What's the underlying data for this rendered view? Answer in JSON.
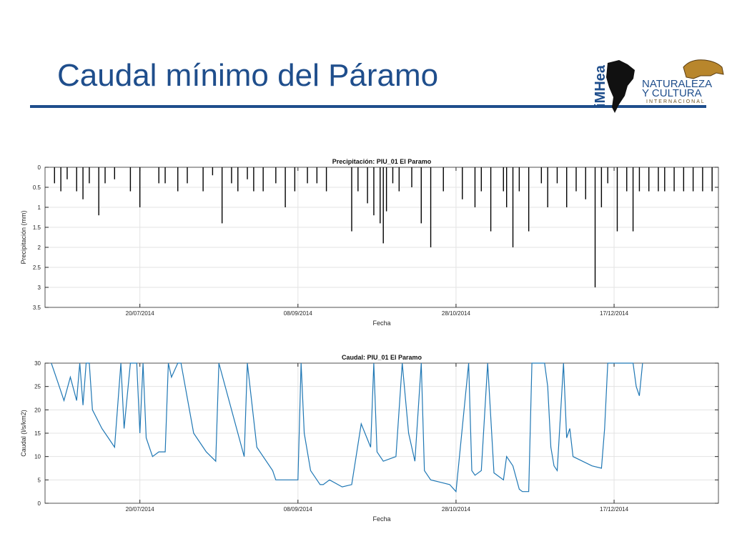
{
  "slide": {
    "title": "Caudal mínimo del Páramo",
    "logo_left_text": "iMHea",
    "logo_right_lines": [
      "NATURALEZA",
      "Y CULTURA",
      "INTERNACIONAL"
    ],
    "logo_icons": [
      "south-america-map-icon",
      "jaguar-icon"
    ],
    "colors": {
      "title": "#1f4e8c",
      "rule": "#1f4e8c",
      "precip_bars": "#000000",
      "flow_line": "#1f77b4"
    }
  },
  "chart_data": [
    {
      "type": "bar",
      "title": "Precipitación: PIU_01 El Paramo",
      "xlabel": "Fecha",
      "ylabel": "Precipitación (mm)",
      "y_reversed": true,
      "ylim": [
        0,
        3.5
      ],
      "yticks": [
        0,
        0.5,
        1,
        1.5,
        2,
        2.5,
        3,
        3.5
      ],
      "ytick_labels": [
        "0",
        "0.5",
        "1",
        "1.5",
        "2",
        "2.5",
        "3",
        "3.5"
      ],
      "xlim": [
        "2014-06-20",
        "2015-01-19"
      ],
      "xticks": [
        "2014-07-20",
        "2014-09-08",
        "2014-10-28",
        "2014-12-17"
      ],
      "xtick_labels": [
        "20/07/2014",
        "08/09/2014",
        "28/10/2014",
        "17/12/2014"
      ],
      "grid": true,
      "series": [
        {
          "dates": [
            "2014-06-23",
            "2014-06-25",
            "2014-06-27",
            "2014-06-30",
            "2014-07-02",
            "2014-07-04",
            "2014-07-07",
            "2014-07-09",
            "2014-07-12",
            "2014-07-17",
            "2014-07-20",
            "2014-07-26",
            "2014-07-28",
            "2014-08-01",
            "2014-08-04",
            "2014-08-09",
            "2014-08-12",
            "2014-08-15",
            "2014-08-18",
            "2014-08-20",
            "2014-08-23",
            "2014-08-25",
            "2014-08-28",
            "2014-09-01",
            "2014-09-04",
            "2014-09-07",
            "2014-09-11",
            "2014-09-14",
            "2014-09-17",
            "2014-09-25",
            "2014-09-27",
            "2014-09-30",
            "2014-10-02",
            "2014-10-04",
            "2014-10-05",
            "2014-10-06",
            "2014-10-08",
            "2014-10-10",
            "2014-10-14",
            "2014-10-17",
            "2014-10-20",
            "2014-10-24",
            "2014-10-30",
            "2014-11-03",
            "2014-11-05",
            "2014-11-08",
            "2014-11-12",
            "2014-11-13",
            "2014-11-15",
            "2014-11-17",
            "2014-11-20",
            "2014-11-24",
            "2014-11-26",
            "2014-11-29",
            "2014-12-02",
            "2014-12-05",
            "2014-12-08",
            "2014-12-11",
            "2014-12-13",
            "2014-12-15",
            "2014-12-18",
            "2014-12-21",
            "2014-12-23",
            "2014-12-25",
            "2014-12-28",
            "2014-12-31",
            "2015-01-02",
            "2015-01-05",
            "2015-01-08",
            "2015-01-11",
            "2015-01-14",
            "2015-01-17"
          ],
          "values": [
            0.4,
            0.6,
            0.3,
            0.6,
            0.8,
            0.4,
            1.2,
            0.4,
            0.3,
            0.6,
            1.0,
            0.4,
            0.4,
            0.6,
            0.4,
            0.6,
            0.2,
            1.4,
            0.4,
            0.6,
            0.3,
            0.6,
            0.6,
            0.4,
            1.0,
            0.6,
            0.4,
            0.4,
            0.6,
            1.6,
            0.6,
            0.9,
            1.2,
            1.4,
            1.9,
            1.1,
            0.4,
            0.6,
            0.5,
            1.4,
            2.0,
            0.6,
            0.8,
            1.0,
            0.6,
            1.6,
            0.6,
            1.0,
            2.0,
            0.6,
            1.6,
            0.4,
            1.0,
            0.4,
            1.0,
            0.6,
            0.8,
            3.0,
            1.0,
            0.4,
            1.6,
            0.6,
            1.6,
            0.6,
            0.6,
            0.6,
            0.6,
            0.6,
            0.6,
            0.6,
            0.6,
            0.6
          ]
        }
      ]
    },
    {
      "type": "line",
      "title": "Caudal: PIU_01 El Paramo",
      "xlabel": "Fecha",
      "ylabel": "Caudal (l/s/km2)",
      "ylim": [
        0,
        30
      ],
      "yticks": [
        0,
        5,
        10,
        15,
        20,
        25,
        30
      ],
      "ytick_labels": [
        "0",
        "5",
        "10",
        "15",
        "20",
        "25",
        "30"
      ],
      "xlim": [
        "2014-06-20",
        "2015-01-19"
      ],
      "xticks": [
        "2014-07-20",
        "2014-09-08",
        "2014-10-28",
        "2014-12-17"
      ],
      "xtick_labels": [
        "20/07/2014",
        "08/09/2014",
        "28/10/2014",
        "17/12/2014"
      ],
      "grid": true,
      "series": [
        {
          "x": [
            "2014-06-22",
            "2014-06-24",
            "2014-06-26",
            "2014-06-28",
            "2014-06-30",
            "2014-07-01",
            "2014-07-02",
            "2014-07-03",
            "2014-07-04",
            "2014-07-05",
            "2014-07-08",
            "2014-07-10",
            "2014-07-12",
            "2014-07-14",
            "2014-07-15",
            "2014-07-17",
            "2014-07-19",
            "2014-07-20",
            "2014-07-21",
            "2014-07-22",
            "2014-07-23",
            "2014-07-24",
            "2014-07-26",
            "2014-07-28",
            "2014-07-29",
            "2014-07-30",
            "2014-08-01",
            "2014-08-02",
            "2014-08-06",
            "2014-08-10",
            "2014-08-13",
            "2014-08-13",
            "2014-08-14",
            "2014-08-22",
            "2014-08-23",
            "2014-08-26",
            "2014-08-31",
            "2014-09-01",
            "2014-09-05",
            "2014-09-08",
            "2014-09-09",
            "2014-09-10",
            "2014-09-12",
            "2014-09-15",
            "2014-09-16",
            "2014-09-18",
            "2014-09-22",
            "2014-09-25",
            "2014-09-28",
            "2014-10-01",
            "2014-10-02",
            "2014-10-03",
            "2014-10-05",
            "2014-10-09",
            "2014-10-11",
            "2014-10-13",
            "2014-10-15",
            "2014-10-17",
            "2014-10-18",
            "2014-10-20",
            "2014-10-23",
            "2014-10-26",
            "2014-10-28",
            "2014-11-01",
            "2014-11-02",
            "2014-11-03",
            "2014-11-05",
            "2014-11-07",
            "2014-11-09",
            "2014-11-12",
            "2014-11-13",
            "2014-11-15",
            "2014-11-17",
            "2014-11-18",
            "2014-11-19",
            "2014-11-20",
            "2014-11-21",
            "2014-11-25",
            "2014-11-26",
            "2014-11-27",
            "2014-11-28",
            "2014-11-29",
            "2014-12-01",
            "2014-12-02",
            "2014-12-03",
            "2014-12-04",
            "2014-12-10",
            "2014-12-13",
            "2014-12-14",
            "2014-12-15",
            "2014-12-16",
            "2014-12-18",
            "2014-12-20",
            "2014-12-22",
            "2014-12-23",
            "2014-12-24",
            "2014-12-25",
            "2014-12-26"
          ],
          "values": [
            30,
            26,
            22,
            27,
            22,
            30,
            21,
            30,
            30,
            20,
            16,
            14,
            12,
            30,
            16,
            30,
            30,
            15,
            30,
            14,
            12,
            10,
            11,
            11,
            30,
            27,
            30,
            30,
            15,
            11,
            9,
            9,
            30,
            10,
            30,
            12,
            7,
            5,
            5,
            5,
            30,
            15,
            7,
            4,
            4,
            5,
            3.5,
            4,
            17,
            12,
            30,
            11,
            9,
            10,
            30,
            15,
            9,
            30,
            7,
            5,
            4.5,
            4,
            2.5,
            30,
            7,
            6,
            7,
            30,
            6.5,
            5,
            10,
            8,
            3,
            2.5,
            2.5,
            2.5,
            30,
            30,
            25,
            12,
            8,
            7,
            30,
            14,
            16,
            10,
            8,
            7.5,
            16,
            30,
            30,
            30,
            30,
            30,
            30,
            25,
            23,
            30
          ]
        }
      ]
    }
  ]
}
